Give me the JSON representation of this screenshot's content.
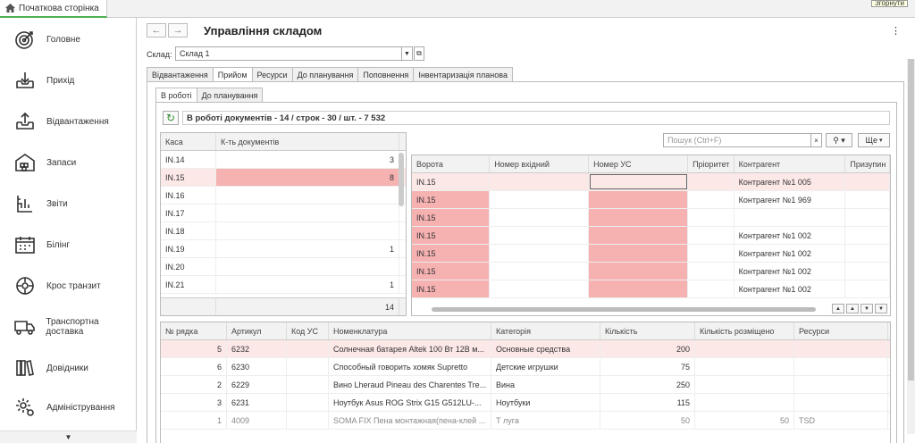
{
  "home_tab": {
    "label": "Початкова сторінка"
  },
  "tooltip": {
    "text": "Згорнути"
  },
  "sidebar": {
    "items": [
      {
        "label": "Головне",
        "icon": "target-icon"
      },
      {
        "label": "Прихід",
        "icon": "inbox-download-icon"
      },
      {
        "label": "Відвантаження",
        "icon": "inbox-upload-icon"
      },
      {
        "label": "Запаси",
        "icon": "warehouse-icon"
      },
      {
        "label": "Звіти",
        "icon": "report-icon"
      },
      {
        "label": "Білінг",
        "icon": "calendar-icon"
      },
      {
        "label": "Крос транзит",
        "icon": "cross-transit-icon"
      },
      {
        "label": "Транспортна доставка",
        "icon": "truck-icon"
      },
      {
        "label": "Довідники",
        "icon": "books-icon"
      },
      {
        "label": "Адміністрування",
        "icon": "settings-icon"
      }
    ]
  },
  "header": {
    "title": "Управління складом",
    "back": "←",
    "forward": "→",
    "more": "⋮"
  },
  "warehouse": {
    "label": "Склад:",
    "value": "Склад 1"
  },
  "tabs": [
    "Відвантаження",
    "Прийом",
    "Ресурси",
    "До планування",
    "Поповнення",
    "Інвентаризація планова"
  ],
  "subtabs": [
    "В роботі",
    "До планування"
  ],
  "summary": "В роботі документів - 14 / строк - 30 / шт. - 7 532",
  "left_grid": {
    "headers": [
      "Каса",
      "К-ть документів"
    ],
    "rows": [
      {
        "kasa": "IN.14",
        "count": "3"
      },
      {
        "kasa": "IN.15",
        "count": "8"
      },
      {
        "kasa": "IN.16",
        "count": ""
      },
      {
        "kasa": "IN.17",
        "count": ""
      },
      {
        "kasa": "IN.18",
        "count": ""
      },
      {
        "kasa": "IN.19",
        "count": "1"
      },
      {
        "kasa": "IN.20",
        "count": ""
      },
      {
        "kasa": "IN.21",
        "count": "1"
      }
    ],
    "total": "14"
  },
  "search": {
    "placeholder": "Пошук (Ctrl+F)",
    "clear": "×",
    "more_label": "Ще"
  },
  "right_grid": {
    "headers": [
      "Ворота",
      "Номер вхідний",
      "Номер УС",
      "Пріоритет",
      "Контрагент",
      "Призупин"
    ],
    "rows": [
      {
        "gate": "IN.15",
        "num_in": "",
        "num_us": "",
        "priority": "",
        "contractor": "Контрагент №1 005"
      },
      {
        "gate": "IN.15",
        "num_in": "",
        "num_us": "",
        "priority": "",
        "contractor": "Контрагент №1 969"
      },
      {
        "gate": "IN.15",
        "num_in": "",
        "num_us": "",
        "priority": "",
        "contractor": ""
      },
      {
        "gate": "IN.15",
        "num_in": "",
        "num_us": "",
        "priority": "",
        "contractor": "Контрагент №1 002"
      },
      {
        "gate": "IN.15",
        "num_in": "",
        "num_us": "",
        "priority": "",
        "contractor": "Контрагент №1 002"
      },
      {
        "gate": "IN.15",
        "num_in": "",
        "num_us": "",
        "priority": "",
        "contractor": "Контрагент №1 002"
      },
      {
        "gate": "IN.15",
        "num_in": "",
        "num_us": "",
        "priority": "",
        "contractor": "Контрагент №1 002"
      }
    ]
  },
  "bottom_grid": {
    "headers": [
      "№ рядка",
      "Артикул",
      "Код УС",
      "Номенклатура",
      "Категорія",
      "Кількість",
      "Кількість розміщено",
      "Ресурси"
    ],
    "rows": [
      {
        "n": "5",
        "art": "6232",
        "code": "",
        "name": "Солнечная батарея Altek 100 Вт 12В м...",
        "cat": "Основные средства",
        "qty": "200",
        "placed": "",
        "res": ""
      },
      {
        "n": "6",
        "art": "6230",
        "code": "",
        "name": "Способный говорить хомяк Supretto",
        "cat": "Детские игрушки",
        "qty": "75",
        "placed": "",
        "res": ""
      },
      {
        "n": "2",
        "art": "6229",
        "code": "",
        "name": "Вино Lheraud Pineau des Charentes Tre...",
        "cat": "Вина",
        "qty": "250",
        "placed": "",
        "res": ""
      },
      {
        "n": "3",
        "art": "6231",
        "code": "",
        "name": "Ноутбук Asus ROG Strix G15 G512LU-...",
        "cat": "Ноутбуки",
        "qty": "115",
        "placed": "",
        "res": ""
      },
      {
        "n": "1",
        "art": "4009",
        "code": "",
        "name": "SOMA FIX Пена монтажная(пена-клей ...",
        "cat": "Т луга",
        "qty": "50",
        "placed": "50",
        "res": "TSD"
      }
    ]
  },
  "colors": {
    "accent": "#4caf50",
    "highlight": "#fde8e8",
    "pink": "#f6b1b1"
  }
}
